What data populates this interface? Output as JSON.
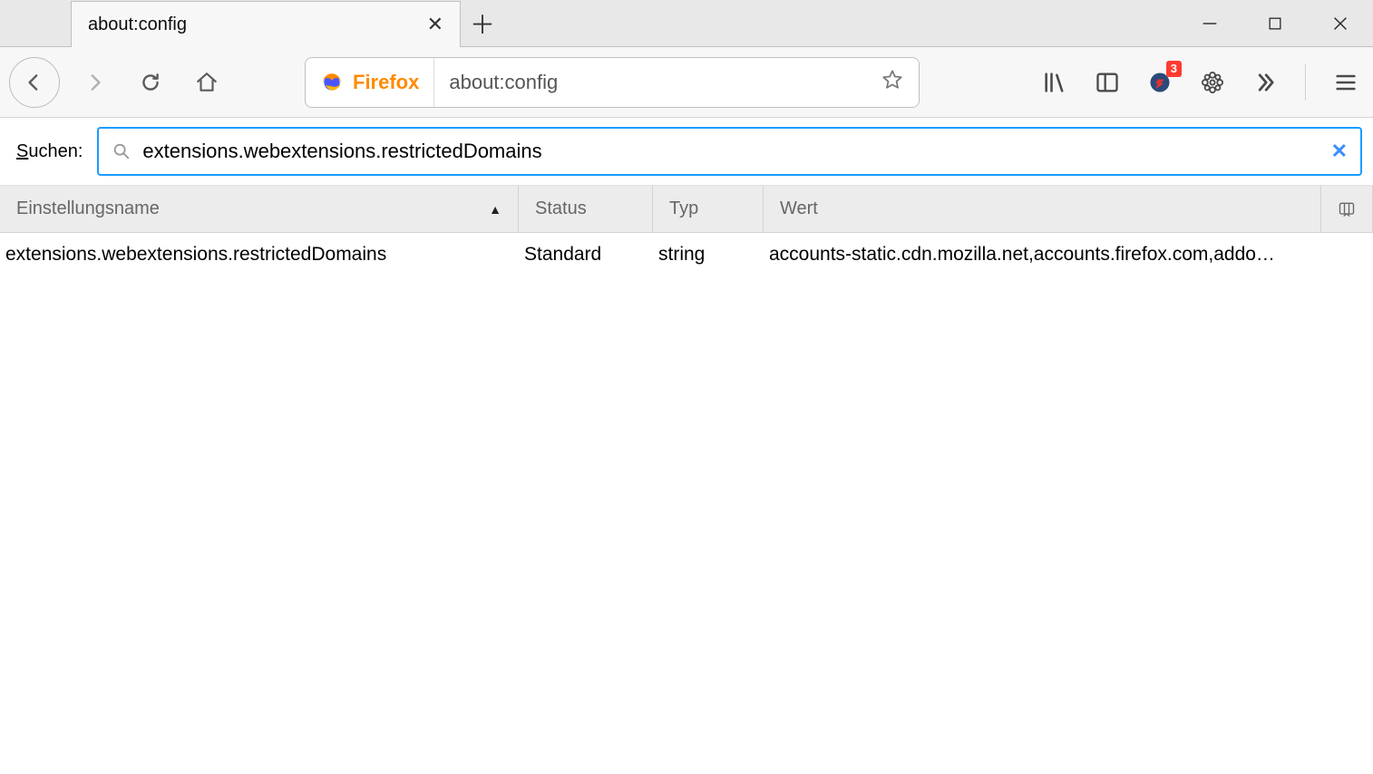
{
  "tab": {
    "title": "about:config"
  },
  "urlbar": {
    "identity_label": "Firefox",
    "url": "about:config"
  },
  "toolbar": {
    "badge_count": "3"
  },
  "config": {
    "search_label_prefix": "S",
    "search_label_rest": "uchen:",
    "search_value": "extensions.webextensions.restrictedDomains",
    "columns": {
      "name": "Einstellungsname",
      "status": "Status",
      "type": "Typ",
      "value": "Wert"
    },
    "rows": [
      {
        "name": "extensions.webextensions.restrictedDomains",
        "status": "Standard",
        "type": "string",
        "value": "accounts-static.cdn.mozilla.net,accounts.firefox.com,addo…"
      }
    ]
  }
}
